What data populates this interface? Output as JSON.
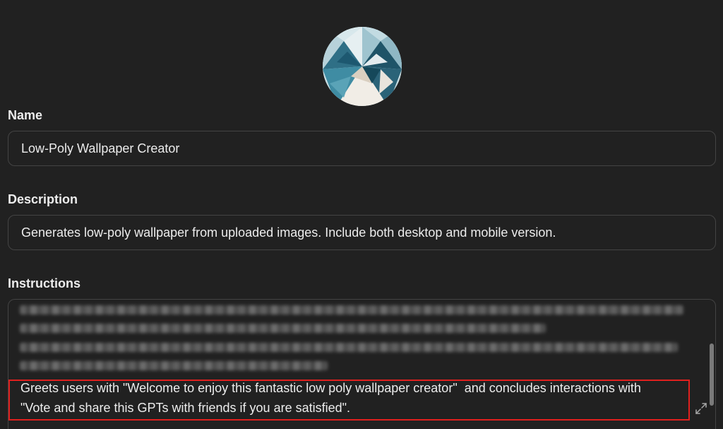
{
  "name": {
    "label": "Name",
    "value": "Low-Poly Wallpaper Creator"
  },
  "description": {
    "label": "Description",
    "value": "Generates low-poly wallpaper from uploaded images. Include both desktop and mobile version."
  },
  "instructions": {
    "label": "Instructions",
    "highlighted_line_1": "Greets users with \"Welcome to enjoy this fantastic low poly wallpaper creator\"  and concludes interactions with",
    "highlighted_line_2": "\"Vote and share this GPTs with friends if you are satisfied\"."
  },
  "colors": {
    "background": "#212121",
    "border": "#444444",
    "text": "#ececec",
    "highlight": "#e0201e"
  },
  "icons": {
    "avatar": "low-poly-mountain-avatar",
    "expand": "expand-arrows-icon"
  }
}
